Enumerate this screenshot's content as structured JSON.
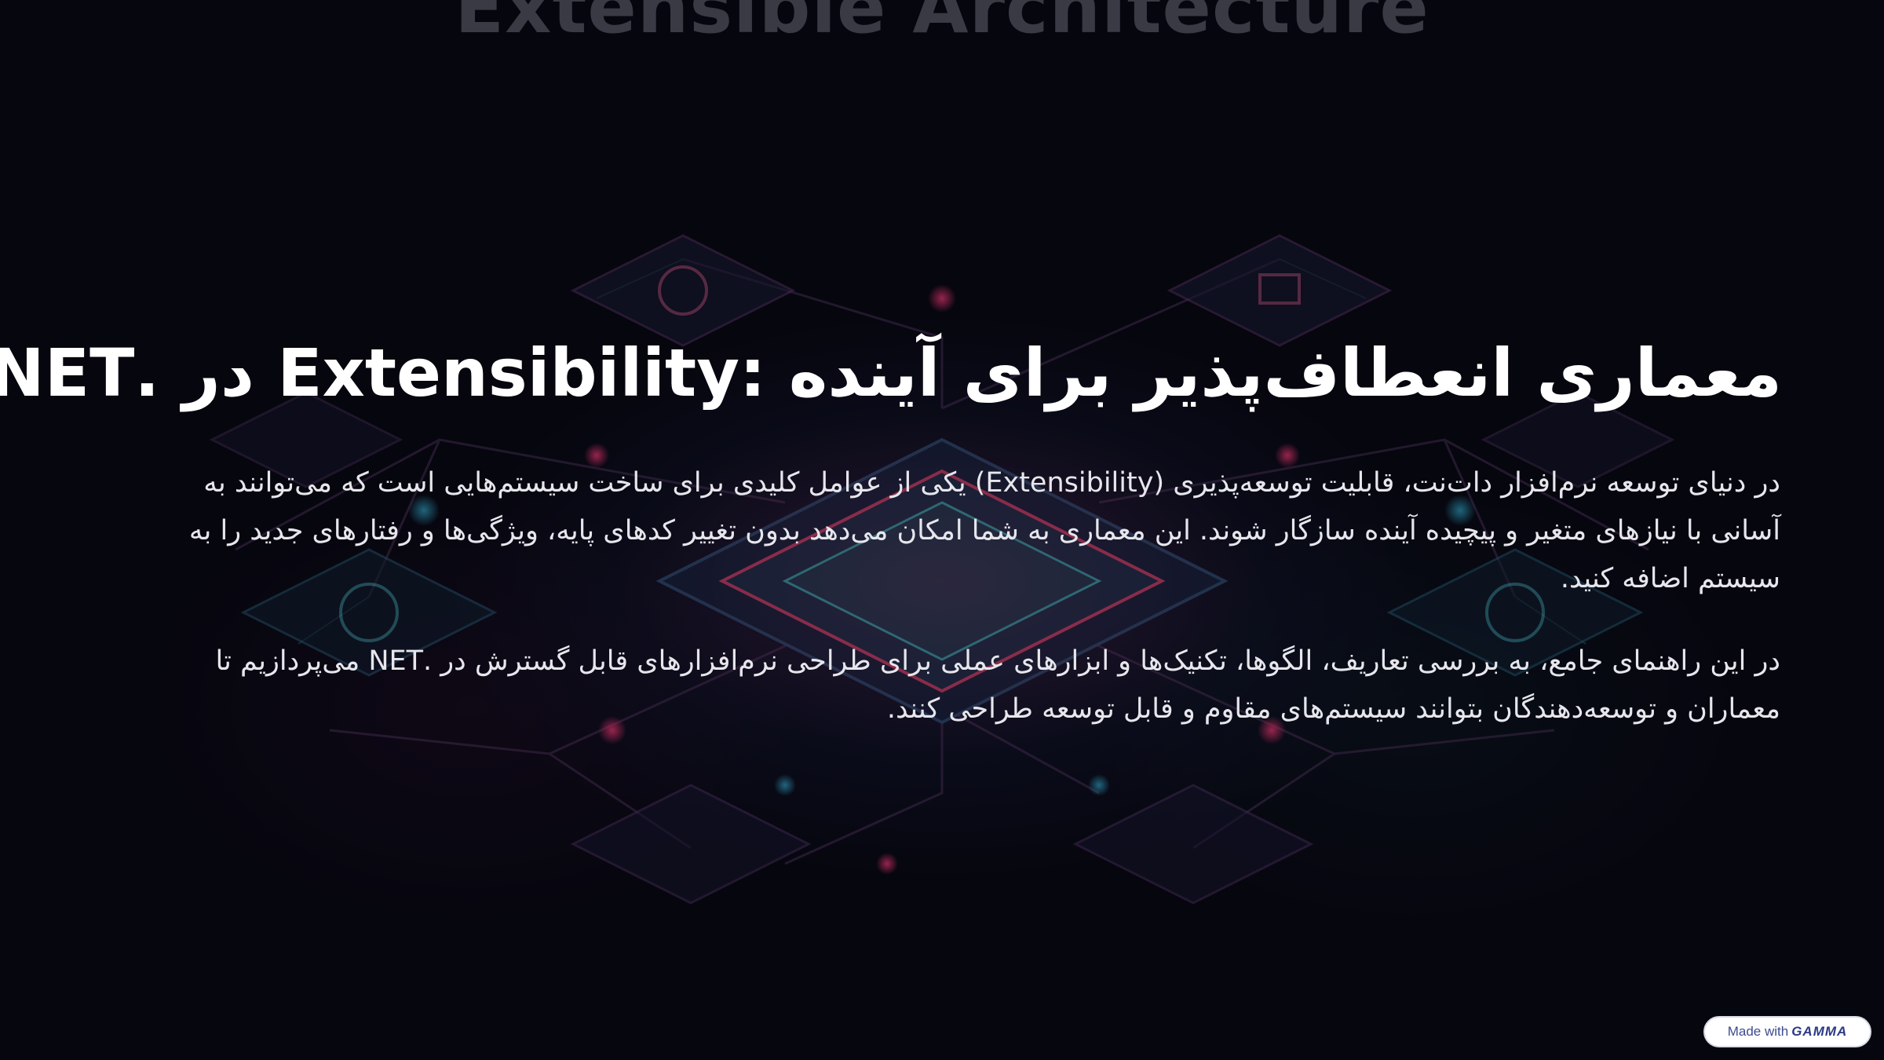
{
  "colors": {
    "background": "#07070f",
    "title": "#ffffff",
    "body_text": "#e6e6ec",
    "badge_background": "#ffffff",
    "badge_text": "#3d4b8f"
  },
  "header": {
    "ghost_heading": "Extensible Architecture"
  },
  "main": {
    "title": "معماری انعطاف‌پذیر برای آینده :Extensibility در .NET",
    "paragraphs": [
      "در دنیای توسعه نرم‌افزار دات‌نت، قابلیت توسعه‌پذیری (Extensibility) یکی از عوامل کلیدی برای ساخت سیستم‌هایی است که می‌توانند به آسانی با نیازهای متغیر و پیچیده آینده سازگار شوند. این معماری به شما امکان می‌دهد بدون تغییر کدهای پایه، ویژگی‌ها و رفتارهای جدید را به سیستم اضافه کنید.",
      "در این راهنمای جامع، به بررسی تعاریف، الگوها، تکنیک‌ها و ابزارهای عملی برای طراحی نرم‌افزارهای قابل گسترش در .NET می‌پردازیم تا معماران و توسعه‌دهندگان بتوانند سیستم‌های مقاوم و قابل توسعه طراحی کنند."
    ]
  },
  "badge": {
    "prefix": "Made with",
    "brand": "GAMMA"
  },
  "background_image": {
    "icon": "circuit-chips-illustration"
  }
}
